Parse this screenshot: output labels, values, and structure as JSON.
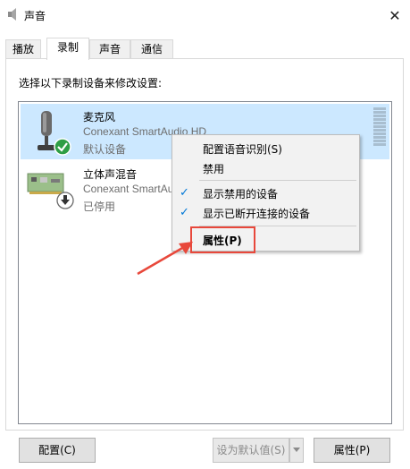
{
  "window": {
    "title": "声音",
    "close_glyph": "✕"
  },
  "tabs": [
    {
      "label": "播放"
    },
    {
      "label": "录制"
    },
    {
      "label": "声音"
    },
    {
      "label": "通信"
    }
  ],
  "active_tab": "录制",
  "instruction": "选择以下录制设备来修改设置:",
  "devices": [
    {
      "name": "麦克风",
      "driver": "Conexant SmartAudio HD",
      "status": "默认设备",
      "icon": "microphone-icon",
      "badge": "default-checkmark-icon",
      "selected": true
    },
    {
      "name": "立体声混音",
      "driver": "Conexant SmartAudio HD",
      "status": "已停用",
      "icon": "stereo-mix-card-icon",
      "badge": "disabled-arrow-icon",
      "selected": false
    }
  ],
  "context_menu": {
    "items": [
      {
        "label": "配置语音识别(S)",
        "checked": false
      },
      {
        "label": "禁用",
        "checked": false
      },
      {
        "label": "显示禁用的设备",
        "checked": true
      },
      {
        "label": "显示已断开连接的设备",
        "checked": true
      },
      {
        "label": "属性(P)",
        "checked": false,
        "bold": true
      }
    ],
    "check_glyph": "✓"
  },
  "buttons": {
    "configure": "配置(C)",
    "set_default": "设为默认值(S)",
    "properties": "属性(P)"
  },
  "colors": {
    "selection": "#cce8ff",
    "annotation_red": "#e8483b",
    "check_blue": "#0078d7"
  }
}
